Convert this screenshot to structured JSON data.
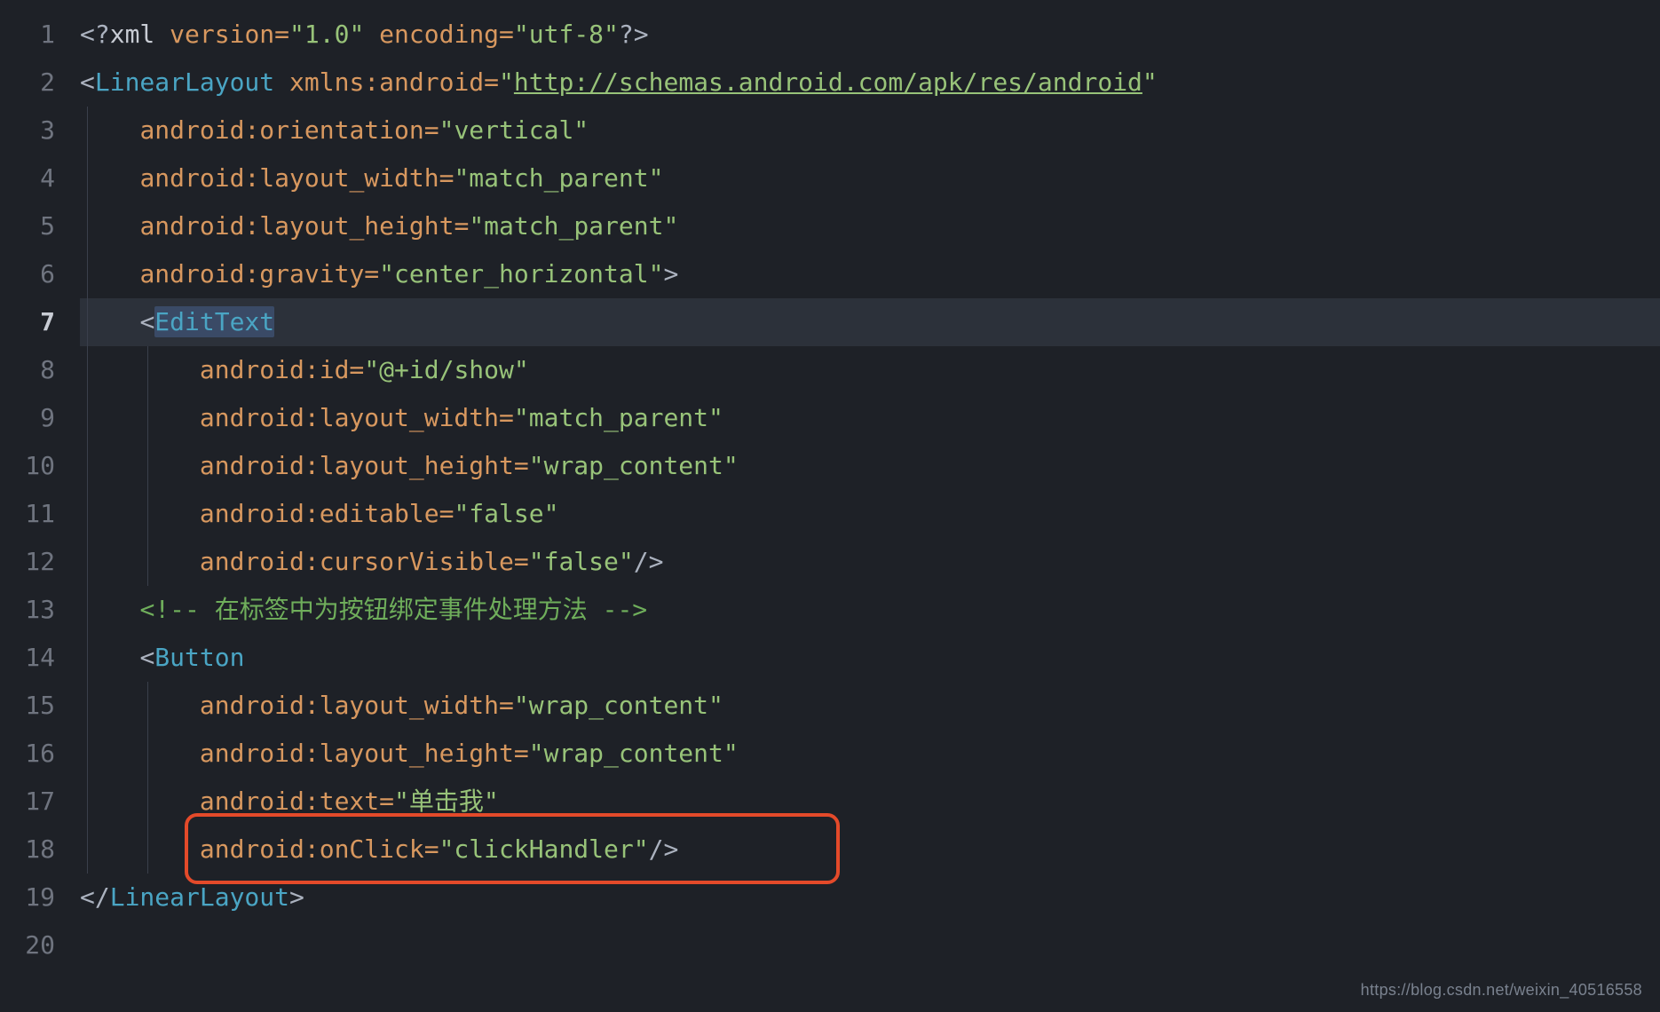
{
  "line_numbers": [
    "1",
    "2",
    "3",
    "4",
    "5",
    "6",
    "7",
    "8",
    "9",
    "10",
    "11",
    "12",
    "13",
    "14",
    "15",
    "16",
    "17",
    "18",
    "19",
    "20"
  ],
  "active_line_index": 6,
  "line1": {
    "pi_open": "<?",
    "xml": "xml ",
    "attr1": "version=",
    "val1": "\"1.0\"",
    "sp": " ",
    "attr2": "encoding=",
    "val2": "\"utf-8\"",
    "pi_close": "?>"
  },
  "line2": {
    "lt": "<",
    "tag": "LinearLayout",
    "sp": " ",
    "attr": "xmlns:android=",
    "q1": "\"",
    "url": "http://schemas.android.com/apk/res/android",
    "q2": "\""
  },
  "line3": {
    "attr": "android:orientation=",
    "val": "\"vertical\""
  },
  "line4": {
    "attr": "android:layout_width=",
    "val": "\"match_parent\""
  },
  "line5": {
    "attr": "android:layout_height=",
    "val": "\"match_parent\""
  },
  "line6": {
    "attr": "android:gravity=",
    "val": "\"center_horizontal\"",
    "close": ">"
  },
  "line7": {
    "lt": "<",
    "tag": "EditText"
  },
  "line8": {
    "attr": "android:id=",
    "val": "\"@+id/show\""
  },
  "line9": {
    "attr": "android:layout_width=",
    "val": "\"match_parent\""
  },
  "line10": {
    "attr": "android:layout_height=",
    "val": "\"wrap_content\""
  },
  "line11": {
    "attr": "android:editable=",
    "val": "\"false\""
  },
  "line12": {
    "attr": "android:cursorVisible=",
    "val": "\"false\"",
    "close": "/>"
  },
  "line13": {
    "open": "<!-- ",
    "text": "在标签中为按钮绑定事件处理方法 ",
    "close": "-->"
  },
  "line14": {
    "lt": "<",
    "tag": "Button"
  },
  "line15": {
    "attr": "android:layout_width=",
    "val": "\"wrap_content\""
  },
  "line16": {
    "attr": "android:layout_height=",
    "val": "\"wrap_content\""
  },
  "line17": {
    "attr": "android:text=",
    "val": "\"单击我\""
  },
  "line18": {
    "attr": "android:onClick=",
    "val": "\"clickHandler\"",
    "close": "/>"
  },
  "line19": {
    "lt": "</",
    "tag": "LinearLayout",
    "gt": ">"
  },
  "indent": {
    "one": "    ",
    "two": "        ",
    "three": "            "
  },
  "watermark": "https://blog.csdn.net/weixin_40516558"
}
